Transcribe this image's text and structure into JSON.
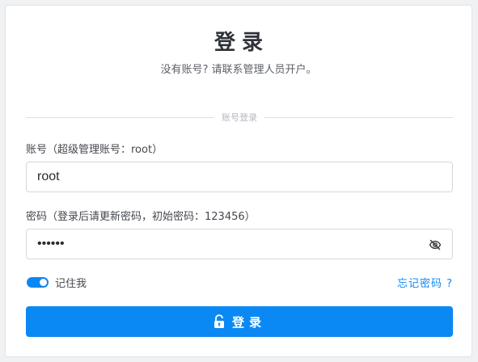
{
  "header": {
    "title": "登录",
    "subtitle": "没有账号? 请联系管理人员开户。"
  },
  "divider": {
    "text": "账号登录"
  },
  "form": {
    "account": {
      "label": "账号（超级管理账号：root）",
      "value": "root"
    },
    "password": {
      "label": "密码（登录后请更新密码，初始密码：123456）",
      "value": "123456",
      "masked": true
    },
    "remember": {
      "label": "记住我",
      "checked": true
    },
    "forgot_label": "忘记密码 ?",
    "submit_label": "登录"
  },
  "icons": {
    "password_toggle": "eye-slash-icon",
    "submit": "unlock-icon"
  },
  "colors": {
    "accent": "#0a89f5",
    "link": "#1487f5"
  }
}
